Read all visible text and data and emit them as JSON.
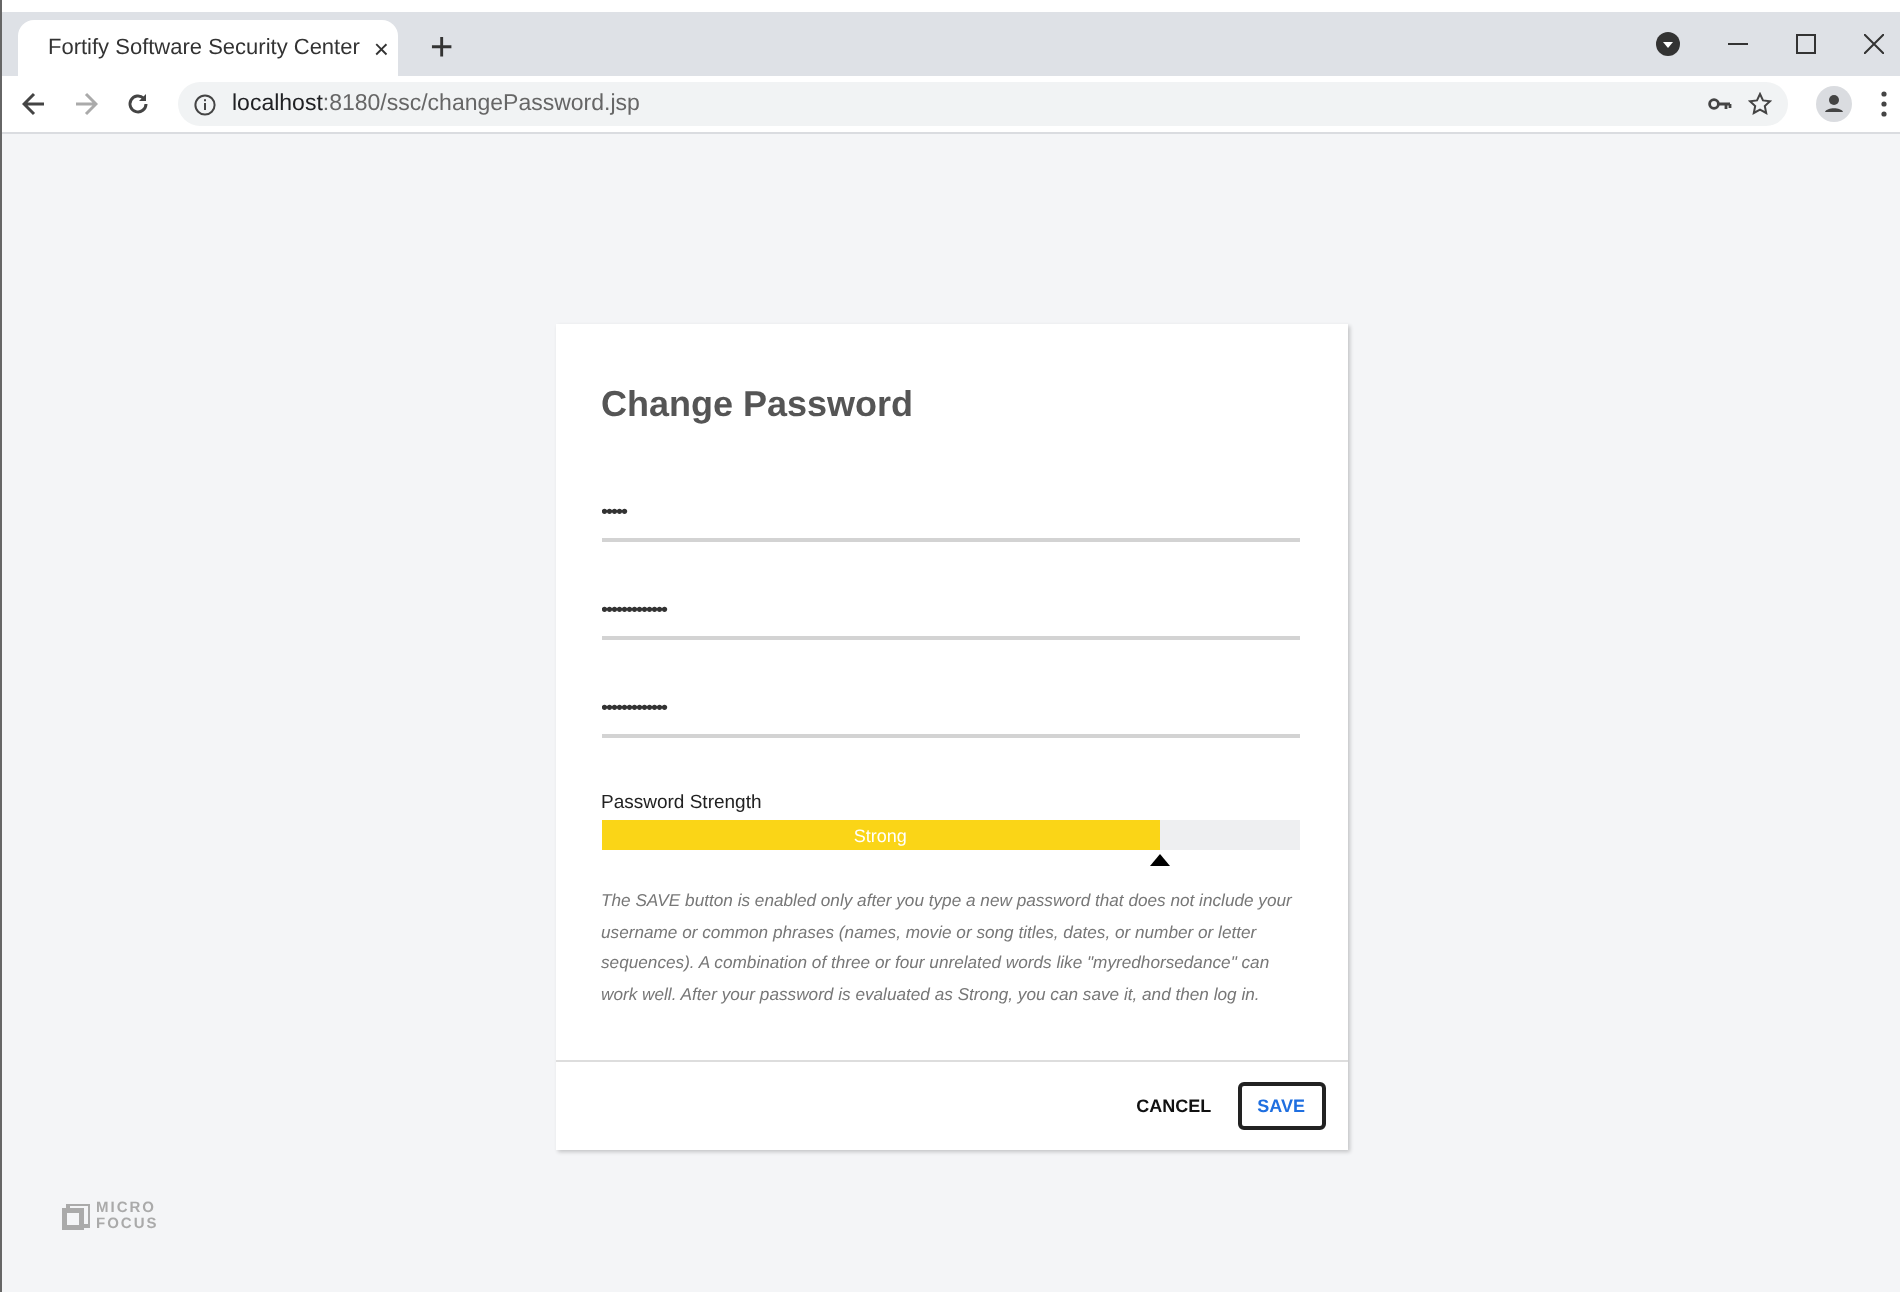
{
  "browser": {
    "tab_title": "Fortify Software Security Center",
    "tab_close": "×",
    "new_tab": "+",
    "url_host": "localhost",
    "url_path": ":8180/ssc/changePassword.jsp"
  },
  "dialog": {
    "title": "Change Password",
    "fields": [
      {
        "value": "•••••"
      },
      {
        "value": "•••••••••••••"
      },
      {
        "value": "•••••••••••••"
      }
    ],
    "strength": {
      "label": "Password Strength",
      "reading": "Strong",
      "level": 0.8
    },
    "help": "The SAVE button is enabled only after you type a new password that does not include your username or common phrases (names, movie or song titles, dates, or number or letter sequences). A combination of three or four unrelated words like \"myredhorsedance\" can work well. After your password is evaluated as Strong, you can save it, and then log in.",
    "buttons": [
      {
        "label": "CANCEL",
        "kind": "text"
      },
      {
        "label": "SAVE",
        "kind": "outlined"
      }
    ]
  },
  "logo": {
    "line_1": "MICRO",
    "line_2": "FOCUS"
  }
}
